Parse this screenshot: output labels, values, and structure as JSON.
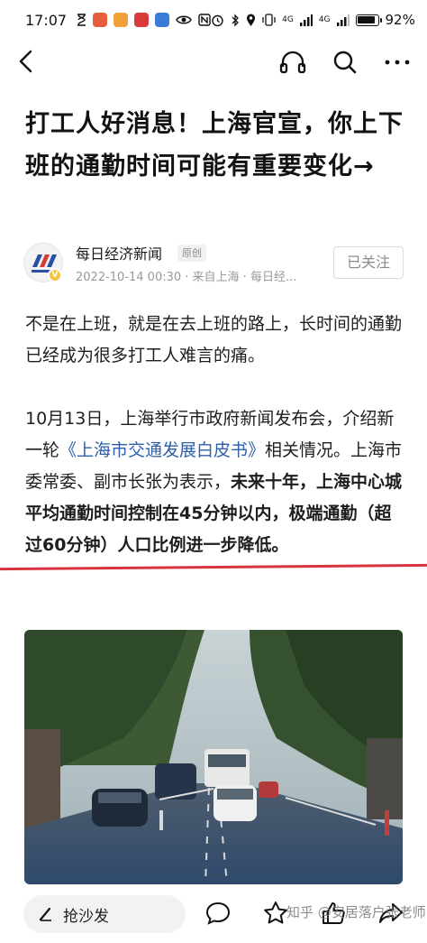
{
  "status_bar": {
    "time": "17:07",
    "network_1": "4G",
    "network_2": "4G",
    "battery_percent": 92,
    "battery_text": "92%"
  },
  "nav": {
    "icons": [
      "back-arrow-icon",
      "headset-icon",
      "search-icon",
      "more-icon"
    ]
  },
  "article": {
    "title": "打工人好消息！上海官宣，你上下班的通勤时间可能有重要变化→",
    "author": {
      "name": "每日经济新闻",
      "original_badge": "原创",
      "meta": "2022-10-14 00:30 · 来自上海 · 每日经...",
      "follow_label": "已关注",
      "verified_mark": "V"
    },
    "paragraphs": {
      "p1": "不是在上班，就是在去上班的路上，长时间的通勤已经成为很多打工人难言的痛。",
      "p2_part1": "10月13日，上海举行市政府新闻发布会，介绍新一轮",
      "p2_link": "《上海市交通发展白皮书》",
      "p2_part2": "相关情况。上海市委常委、副市长张为表示，",
      "p2_bold": "未来十年，上海中心城平均通勤时间控制在45分钟以内，极端通勤（超过60分钟）人口比例进一步降低。"
    }
  },
  "bottom_bar": {
    "comment_label": "抢沙发",
    "watermark": "知乎 @安居落户张老师"
  },
  "colors": {
    "link": "#2f5faa",
    "underline_red": "#d8343f"
  }
}
